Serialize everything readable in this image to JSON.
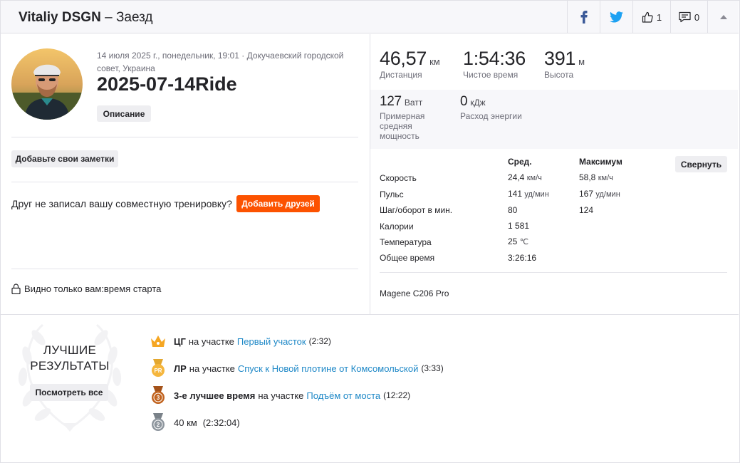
{
  "header": {
    "athlete": "Vitaliy DSGN",
    "separator_title": "– Заезд",
    "kudos_count": "1",
    "comments_count": "0",
    "icons": [
      "facebook-icon",
      "twitter-icon",
      "thumbs-up-icon",
      "comment-icon",
      "chevron-up-icon"
    ]
  },
  "activity": {
    "meta": "14 июля 2025 г., понедельник, 19:01 · Докучаевский городской совет, Украина",
    "name": "2025-07-14Ride",
    "description_label": "Описание",
    "notes_label": "Добавьте свои заметки",
    "friend_prompt": "Друг не записал вашу совместную тренировку?",
    "add_friends_label": "Добавить друзей",
    "visibility_prefix": "Видно только вам:",
    "visibility_value": "время старта"
  },
  "stats": {
    "distance": {
      "value": "46,57",
      "unit": "км",
      "label": "Дистанция"
    },
    "moving_time": {
      "value": "1:54:36",
      "unit": "",
      "label": "Чистое время"
    },
    "elevation": {
      "value": "391",
      "unit": "м",
      "label": "Высота"
    },
    "power": {
      "value": "127",
      "unit": "Ватт",
      "label_1": "Примерная",
      "label_2": "средняя",
      "label_3": "мощность"
    },
    "energy": {
      "value": "0",
      "unit": "кДж",
      "label": "Расход энергии"
    }
  },
  "table": {
    "col_avg": "Сред.",
    "col_max": "Максимум",
    "collapse_label": "Свернуть",
    "rows": [
      {
        "label": "Скорость",
        "avg": "24,4",
        "avg_unit": "км/ч",
        "max": "58,8",
        "max_unit": "км/ч"
      },
      {
        "label": "Пульс",
        "avg": "141",
        "avg_unit": "уд/мин",
        "max": "167",
        "max_unit": "уд/мин"
      },
      {
        "label": "Шаг/оборот в мин.",
        "avg": "80",
        "avg_unit": "",
        "max": "124",
        "max_unit": ""
      },
      {
        "label": "Калории",
        "avg": "1 581",
        "avg_unit": "",
        "max": "",
        "max_unit": ""
      },
      {
        "label": "Температура",
        "avg": "25",
        "avg_unit": "℃",
        "max": "",
        "max_unit": ""
      },
      {
        "label": "Общее время",
        "avg": "3:26:16",
        "avg_unit": "",
        "max": "",
        "max_unit": ""
      }
    ],
    "device": "Magene C206 Pro"
  },
  "best": {
    "title_1": "ЛУЧШИЕ",
    "title_2": "РЕЗУЛЬТАТЫ",
    "see_all_label": "Посмотреть все",
    "items": [
      {
        "badge": "ЦГ",
        "text": "на участке",
        "segment": "Первый участок",
        "time": "(2:32)",
        "icon": "crown-icon"
      },
      {
        "badge": "ЛР",
        "text": "на участке",
        "segment": "Спуск к Новой плотине от Комсомольской",
        "time": "(3:33)",
        "icon": "pr-medal-icon"
      },
      {
        "badge": "3-е лучшее время",
        "text": "на участке",
        "segment": "Подъём от моста",
        "time": "(12:22)",
        "icon": "bronze-medal-icon"
      },
      {
        "badge": "",
        "text": "40 км",
        "segment": "",
        "time": "(2:32:04)",
        "icon": "silver-medal-icon"
      }
    ]
  },
  "colors": {
    "accent": "#fc5200",
    "link": "#1e88c7",
    "facebook": "#3b5998",
    "twitter": "#1da1f2",
    "crown": "#f5a623",
    "bronze": "#c1631f",
    "silver": "#8e969e"
  }
}
